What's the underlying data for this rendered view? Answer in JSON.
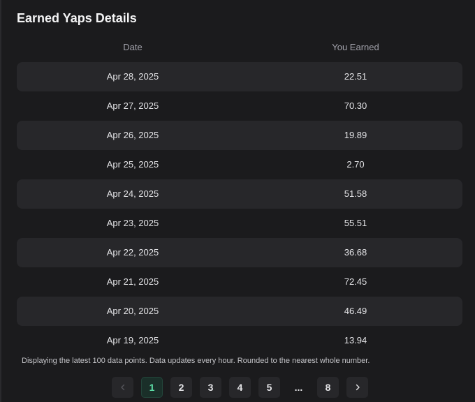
{
  "title": "Earned Yaps Details",
  "table": {
    "headers": {
      "date": "Date",
      "earned": "You Earned"
    },
    "rows": [
      {
        "date": "Apr 28, 2025",
        "earned": "22.51"
      },
      {
        "date": "Apr 27, 2025",
        "earned": "70.30"
      },
      {
        "date": "Apr 26, 2025",
        "earned": "19.89"
      },
      {
        "date": "Apr 25, 2025",
        "earned": "2.70"
      },
      {
        "date": "Apr 24, 2025",
        "earned": "51.58"
      },
      {
        "date": "Apr 23, 2025",
        "earned": "55.51"
      },
      {
        "date": "Apr 22, 2025",
        "earned": "36.68"
      },
      {
        "date": "Apr 21, 2025",
        "earned": "72.45"
      },
      {
        "date": "Apr 20, 2025",
        "earned": "46.49"
      },
      {
        "date": "Apr 19, 2025",
        "earned": "13.94"
      }
    ]
  },
  "note": "Displaying the latest 100 data points. Data updates every hour. Rounded to the nearest whole number.",
  "pagination": {
    "prev_icon": "chevron-left-icon",
    "next_icon": "chevron-right-icon",
    "pages": [
      "1",
      "2",
      "3",
      "4",
      "5"
    ],
    "ellipsis": "...",
    "last": "8",
    "current": "1"
  },
  "colors": {
    "background": "#1b1b1d",
    "row_alt": "#27272a",
    "accent": "#5ee0a8"
  }
}
